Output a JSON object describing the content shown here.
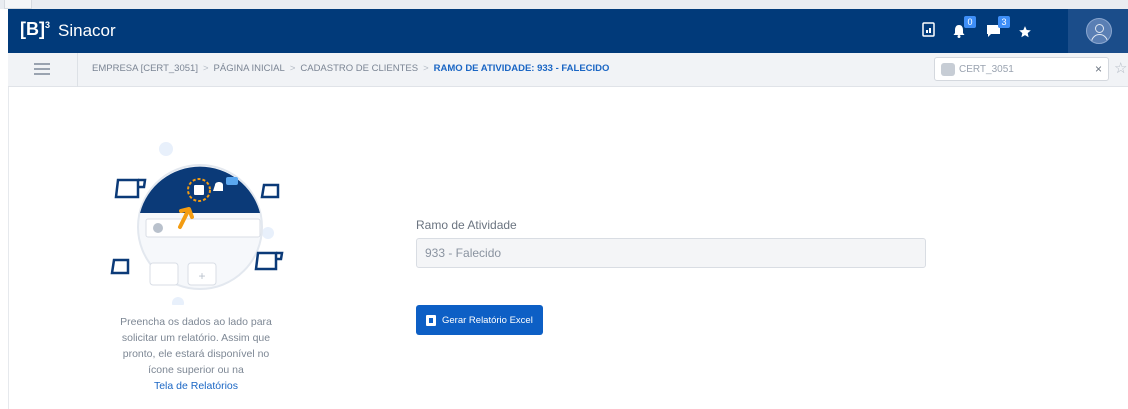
{
  "header": {
    "logo": "[B]",
    "logo_sup": "3",
    "app_name": "Sinacor",
    "notification_count": "0",
    "message_count": "3"
  },
  "breadcrumb": {
    "items": [
      "EMPRESA [CERT_3051]",
      "PÁGINA INICIAL",
      "CADASTRO DE CLIENTES",
      "RAMO DE ATIVIDADE: 933 - FALECIDO"
    ],
    "search_value": "CERT_3051"
  },
  "help": {
    "text_lines": [
      "Preencha os dados ao lado para",
      "solicitar um relatório. Assim que",
      "pronto, ele estará disponível no",
      "ícone superior ou na"
    ],
    "link": "Tela de Relatórios"
  },
  "form": {
    "label": "Ramo de Atividade",
    "value": "933 - Falecido",
    "button": "Gerar Relatório Excel"
  },
  "colors": {
    "header_bg": "#013a7a",
    "accent": "#0d5fc5",
    "illustration_orange": "#f39c12"
  },
  "icons": [
    "report-icon",
    "bell-icon",
    "message-icon",
    "star-icon",
    "avatar-icon",
    "menu-icon",
    "close-icon",
    "excel-icon"
  ]
}
